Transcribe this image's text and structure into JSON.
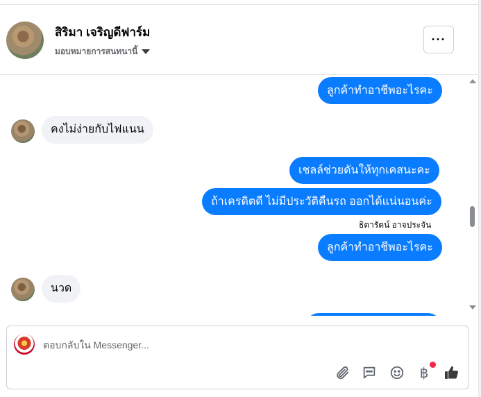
{
  "header": {
    "contact_name": "สิริมา เจริญดีฟาร์ม",
    "assign_label": "มอบหมายการสนทนานี้",
    "more_label": "···"
  },
  "messages": [
    {
      "direction": "out",
      "text": "ลูกค้าทำอาชีพอะไรคะ"
    },
    {
      "direction": "in",
      "text": "คงไม่ง่ายกับไฟแนน"
    },
    {
      "direction": "out",
      "text": "เชลล์ช่วยดันให้ทุกเคสนะคะ"
    },
    {
      "direction": "out",
      "text": "ถ้าเครดิตดี ไม่มีประวัติคืนรถ ออกได้แน่นอนค่ะ"
    },
    {
      "direction": "sender",
      "text": "ธิดารัตน์ อาจประจัน"
    },
    {
      "direction": "out",
      "text": "ลูกค้าทำอาชีพอะไรคะ"
    },
    {
      "direction": "in",
      "text": "นวด"
    }
  ],
  "composer": {
    "placeholder": "ตอบกลับใน Messenger...",
    "baht_symbol": "฿"
  },
  "colors": {
    "outgoing_bubble": "#0a7cff",
    "incoming_bubble": "#f0f2f5",
    "notification_dot": "#f02849"
  },
  "icons": [
    "paperclip-icon",
    "chat-bubble-icon",
    "smiley-icon",
    "baht-icon",
    "thumbs-up-icon"
  ]
}
